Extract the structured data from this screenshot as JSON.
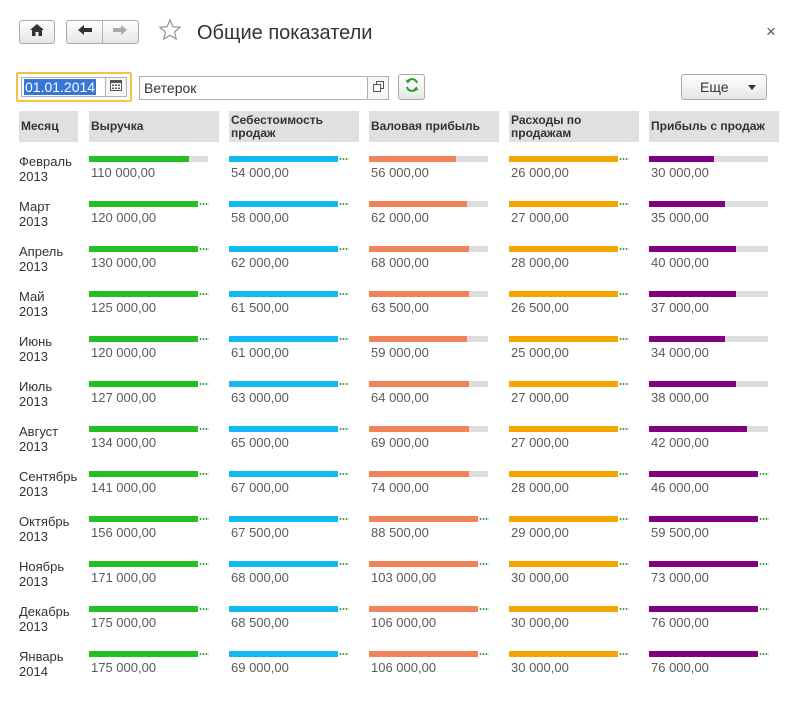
{
  "window": {
    "title": "Общие показатели",
    "close_glyph": "×"
  },
  "toolbar": {
    "date_value": "01.01.2014",
    "organization_value": "Ветерок",
    "more_label": "Еще"
  },
  "colors": {
    "revenue": "#22c022",
    "cost": "#12b9f0",
    "gross": "#f2825a",
    "expenses": "#f5a500",
    "profit": "#800080"
  },
  "columns": [
    {
      "key": "month",
      "lines": [
        "Месяц"
      ]
    },
    {
      "key": "revenue",
      "lines": [
        "Выручка"
      ]
    },
    {
      "key": "cost",
      "lines": [
        "Себестоимость",
        "продаж"
      ]
    },
    {
      "key": "gross",
      "lines": [
        "Валовая прибыль"
      ]
    },
    {
      "key": "expenses",
      "lines": [
        "Расходы по",
        "продажам"
      ]
    },
    {
      "key": "profit",
      "lines": [
        "Прибыль с продаж"
      ]
    }
  ],
  "rows": [
    {
      "month": "Февраль",
      "year": "2013",
      "revenue": {
        "text": "110 000,00",
        "level": 0.92
      },
      "cost": {
        "text": "54 000,00",
        "level": 1.0
      },
      "gross": {
        "text": "56 000,00",
        "level": 0.8
      },
      "expenses": {
        "text": "26 000,00",
        "level": 1.0
      },
      "profit": {
        "text": "30 000,00",
        "level": 0.6
      }
    },
    {
      "month": "Март",
      "year": "2013",
      "revenue": {
        "text": "120 000,00",
        "level": 1.0
      },
      "cost": {
        "text": "58 000,00",
        "level": 1.0
      },
      "gross": {
        "text": "62 000,00",
        "level": 0.9
      },
      "expenses": {
        "text": "27 000,00",
        "level": 1.0
      },
      "profit": {
        "text": "35 000,00",
        "level": 0.7
      }
    },
    {
      "month": "Апрель",
      "year": "2013",
      "revenue": {
        "text": "130 000,00",
        "level": 1.0
      },
      "cost": {
        "text": "62 000,00",
        "level": 1.0
      },
      "gross": {
        "text": "68 000,00",
        "level": 0.92
      },
      "expenses": {
        "text": "28 000,00",
        "level": 1.0
      },
      "profit": {
        "text": "40 000,00",
        "level": 0.8
      }
    },
    {
      "month": "Май",
      "year": "2013",
      "revenue": {
        "text": "125 000,00",
        "level": 1.0
      },
      "cost": {
        "text": "61 500,00",
        "level": 1.0
      },
      "gross": {
        "text": "63 500,00",
        "level": 0.92
      },
      "expenses": {
        "text": "26 500,00",
        "level": 1.0
      },
      "profit": {
        "text": "37 000,00",
        "level": 0.8
      }
    },
    {
      "month": "Июнь",
      "year": "2013",
      "revenue": {
        "text": "120 000,00",
        "level": 1.0
      },
      "cost": {
        "text": "61 000,00",
        "level": 1.0
      },
      "gross": {
        "text": "59 000,00",
        "level": 0.9
      },
      "expenses": {
        "text": "25 000,00",
        "level": 1.0
      },
      "profit": {
        "text": "34 000,00",
        "level": 0.7
      }
    },
    {
      "month": "Июль",
      "year": "2013",
      "revenue": {
        "text": "127 000,00",
        "level": 1.0
      },
      "cost": {
        "text": "63 000,00",
        "level": 1.0
      },
      "gross": {
        "text": "64 000,00",
        "level": 0.92
      },
      "expenses": {
        "text": "27 000,00",
        "level": 1.0
      },
      "profit": {
        "text": "38 000,00",
        "level": 0.8
      }
    },
    {
      "month": "Август",
      "year": "2013",
      "revenue": {
        "text": "134 000,00",
        "level": 1.0
      },
      "cost": {
        "text": "65 000,00",
        "level": 1.0
      },
      "gross": {
        "text": "69 000,00",
        "level": 0.92
      },
      "expenses": {
        "text": "27 000,00",
        "level": 1.0
      },
      "profit": {
        "text": "42 000,00",
        "level": 0.9
      }
    },
    {
      "month": "Сентябрь",
      "year": "2013",
      "revenue": {
        "text": "141 000,00",
        "level": 1.0
      },
      "cost": {
        "text": "67 000,00",
        "level": 1.0
      },
      "gross": {
        "text": "74 000,00",
        "level": 0.92
      },
      "expenses": {
        "text": "28 000,00",
        "level": 1.0
      },
      "profit": {
        "text": "46 000,00",
        "level": 1.0
      }
    },
    {
      "month": "Октябрь",
      "year": "2013",
      "revenue": {
        "text": "156 000,00",
        "level": 1.0
      },
      "cost": {
        "text": "67 500,00",
        "level": 1.0
      },
      "gross": {
        "text": "88 500,00",
        "level": 1.0
      },
      "expenses": {
        "text": "29 000,00",
        "level": 1.0
      },
      "profit": {
        "text": "59 500,00",
        "level": 1.0
      }
    },
    {
      "month": "Ноябрь",
      "year": "2013",
      "revenue": {
        "text": "171 000,00",
        "level": 1.0
      },
      "cost": {
        "text": "68 000,00",
        "level": 1.0
      },
      "gross": {
        "text": "103 000,00",
        "level": 1.0
      },
      "expenses": {
        "text": "30 000,00",
        "level": 1.0
      },
      "profit": {
        "text": "73 000,00",
        "level": 1.0
      }
    },
    {
      "month": "Декабрь",
      "year": "2013",
      "revenue": {
        "text": "175 000,00",
        "level": 1.0
      },
      "cost": {
        "text": "68 500,00",
        "level": 1.0
      },
      "gross": {
        "text": "106 000,00",
        "level": 1.0
      },
      "expenses": {
        "text": "30 000,00",
        "level": 1.0
      },
      "profit": {
        "text": "76 000,00",
        "level": 1.0
      }
    },
    {
      "month": "Январь",
      "year": "2014",
      "revenue": {
        "text": "175 000,00",
        "level": 1.0
      },
      "cost": {
        "text": "69 000,00",
        "level": 1.0
      },
      "gross": {
        "text": "106 000,00",
        "level": 1.0
      },
      "expenses": {
        "text": "30 000,00",
        "level": 1.0
      },
      "profit": {
        "text": "76 000,00",
        "level": 1.0
      }
    }
  ],
  "icons": {
    "home": "home-icon",
    "back": "arrow-left-icon",
    "forward": "arrow-right-icon",
    "favorite": "star-icon",
    "close": "close-icon",
    "calendar": "calendar-icon",
    "open": "open-window-icon",
    "refresh": "refresh-icon",
    "more": "chevron-down-icon"
  }
}
